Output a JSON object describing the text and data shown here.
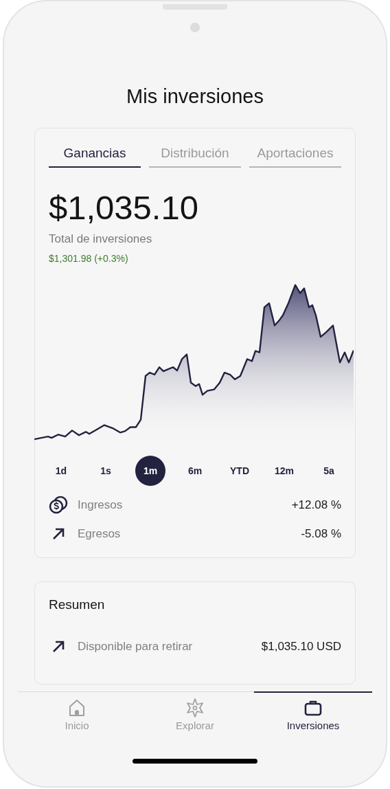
{
  "title": "Mis inversiones",
  "tabs": [
    {
      "label": "Ganancias",
      "selected": true
    },
    {
      "label": "Distribución",
      "selected": false
    },
    {
      "label": "Aportaciones",
      "selected": false
    }
  ],
  "amount": "$1,035.10",
  "amount_caption": "Total de inversiones",
  "change": "$1,301.98 (+0.3%)",
  "periods": [
    {
      "label": "1d",
      "selected": false
    },
    {
      "label": "1s",
      "selected": false
    },
    {
      "label": "1m",
      "selected": true
    },
    {
      "label": "6m",
      "selected": false
    },
    {
      "label": "YTD",
      "selected": false
    },
    {
      "label": "12m",
      "selected": false
    },
    {
      "label": "5a",
      "selected": false
    }
  ],
  "stats": [
    {
      "kind": "coins",
      "label": "Ingresos",
      "value": "+12.08 %"
    },
    {
      "kind": "arrow",
      "label": "Egresos",
      "value": "-5.08 %"
    }
  ],
  "summary": {
    "title": "Resumen",
    "rows": [
      {
        "kind": "arrow",
        "label": "Disponible para retirar",
        "value": "$1,035.10 USD"
      }
    ]
  },
  "nav": [
    {
      "kind": "home",
      "label": "Inicio",
      "selected": false
    },
    {
      "kind": "compass",
      "label": "Explorar",
      "selected": false
    },
    {
      "kind": "briefcase",
      "label": "Inversiones",
      "selected": true
    }
  ]
}
